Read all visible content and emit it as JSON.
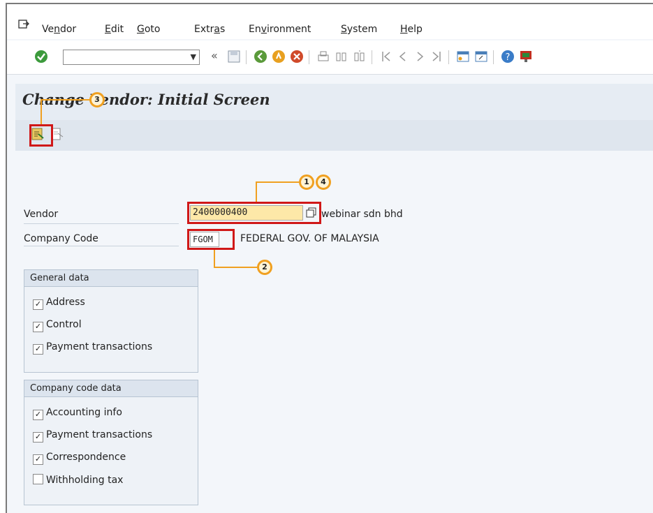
{
  "menu": {
    "items": [
      "Vendor",
      "Edit",
      "Goto",
      "Extras",
      "Environment",
      "System",
      "Help"
    ],
    "underlines": [
      "n",
      "E",
      "G",
      "a",
      "v",
      "S",
      "H"
    ]
  },
  "toolbar": {
    "command_field": "",
    "icons": [
      "enter-icon",
      "dropdown-icon",
      "back-double-icon",
      "save-icon",
      "back-icon",
      "exit-icon",
      "cancel-icon",
      "print-icon",
      "find-icon",
      "find-next-icon",
      "first-page-icon",
      "previous-page-icon",
      "next-page-icon",
      "last-page-icon",
      "create-session-icon",
      "shortcut-icon",
      "help-icon",
      "customize-icon"
    ]
  },
  "title": "Change Vendor: Initial Screen",
  "form": {
    "vendor_label": "Vendor",
    "vendor_value": "2400000400",
    "vendor_desc": "webinar sdn bhd",
    "company_label": "Company Code",
    "company_value": "FGOM",
    "company_desc": "FEDERAL GOV. OF MALAYSIA"
  },
  "general_data": {
    "title": "General data",
    "items": [
      {
        "label": "Address",
        "checked": true
      },
      {
        "label": "Control",
        "checked": true
      },
      {
        "label": "Payment transactions",
        "checked": true
      }
    ]
  },
  "company_code_data": {
    "title": "Company code data",
    "items": [
      {
        "label": "Accounting info",
        "checked": true
      },
      {
        "label": "Payment transactions",
        "checked": true
      },
      {
        "label": "Correspondence",
        "checked": true
      },
      {
        "label": "Withholding tax",
        "checked": false
      }
    ]
  },
  "callouts": [
    "1",
    "2",
    "3",
    "4"
  ],
  "colors": {
    "highlight": "#d01818",
    "callout": "#f0a020",
    "input_active": "#fde8a8"
  }
}
